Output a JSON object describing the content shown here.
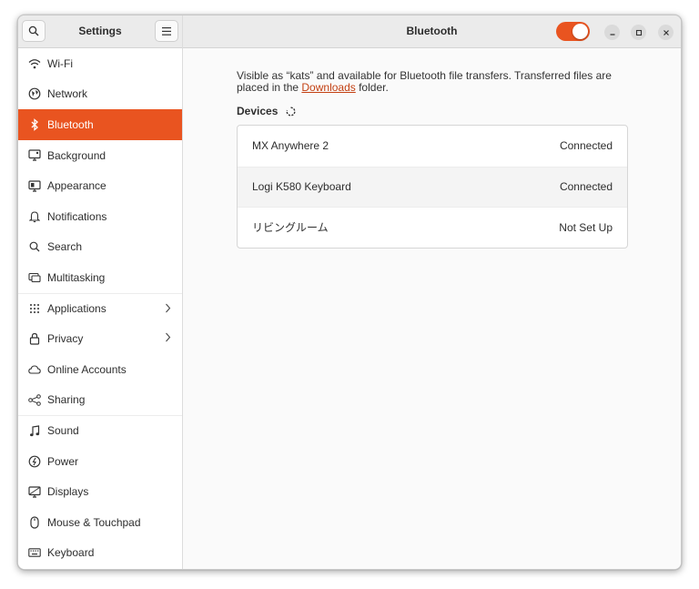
{
  "sidebar": {
    "title": "Settings",
    "search_icon": "search-icon",
    "menu_icon": "hamburger-menu-icon",
    "items": [
      {
        "label": "Wi-Fi",
        "icon": "wifi-icon"
      },
      {
        "label": "Network",
        "icon": "network-icon"
      },
      {
        "label": "Bluetooth",
        "icon": "bluetooth-icon",
        "active": true
      },
      {
        "label": "Background",
        "icon": "background-icon"
      },
      {
        "label": "Appearance",
        "icon": "appearance-icon"
      },
      {
        "label": "Notifications",
        "icon": "bell-icon"
      },
      {
        "label": "Search",
        "icon": "search-icon"
      },
      {
        "label": "Multitasking",
        "icon": "multitasking-icon"
      },
      {
        "label": "Applications",
        "icon": "grid-icon",
        "has_chevron": true
      },
      {
        "label": "Privacy",
        "icon": "lock-icon",
        "has_chevron": true
      },
      {
        "label": "Online Accounts",
        "icon": "cloud-icon"
      },
      {
        "label": "Sharing",
        "icon": "share-icon"
      },
      {
        "label": "Sound",
        "icon": "music-note-icon"
      },
      {
        "label": "Power",
        "icon": "power-icon"
      },
      {
        "label": "Displays",
        "icon": "display-icon"
      },
      {
        "label": "Mouse & Touchpad",
        "icon": "mouse-icon"
      },
      {
        "label": "Keyboard",
        "icon": "keyboard-icon"
      }
    ]
  },
  "header": {
    "title": "Bluetooth",
    "toggle_on": true
  },
  "main": {
    "info_before_link": "Visible as “kats” and available for Bluetooth file transfers. Transferred files are placed in the ",
    "info_link": "Downloads",
    "info_after_link": " folder.",
    "devices_label": "Devices",
    "devices": [
      {
        "name": "MX Anywhere 2",
        "status": "Connected"
      },
      {
        "name": "Logi K580 Keyboard",
        "status": "Connected"
      },
      {
        "name": "リビングルーム",
        "status": "Not Set Up"
      }
    ]
  },
  "colors": {
    "accent": "#e95420",
    "link": "#c34113"
  }
}
